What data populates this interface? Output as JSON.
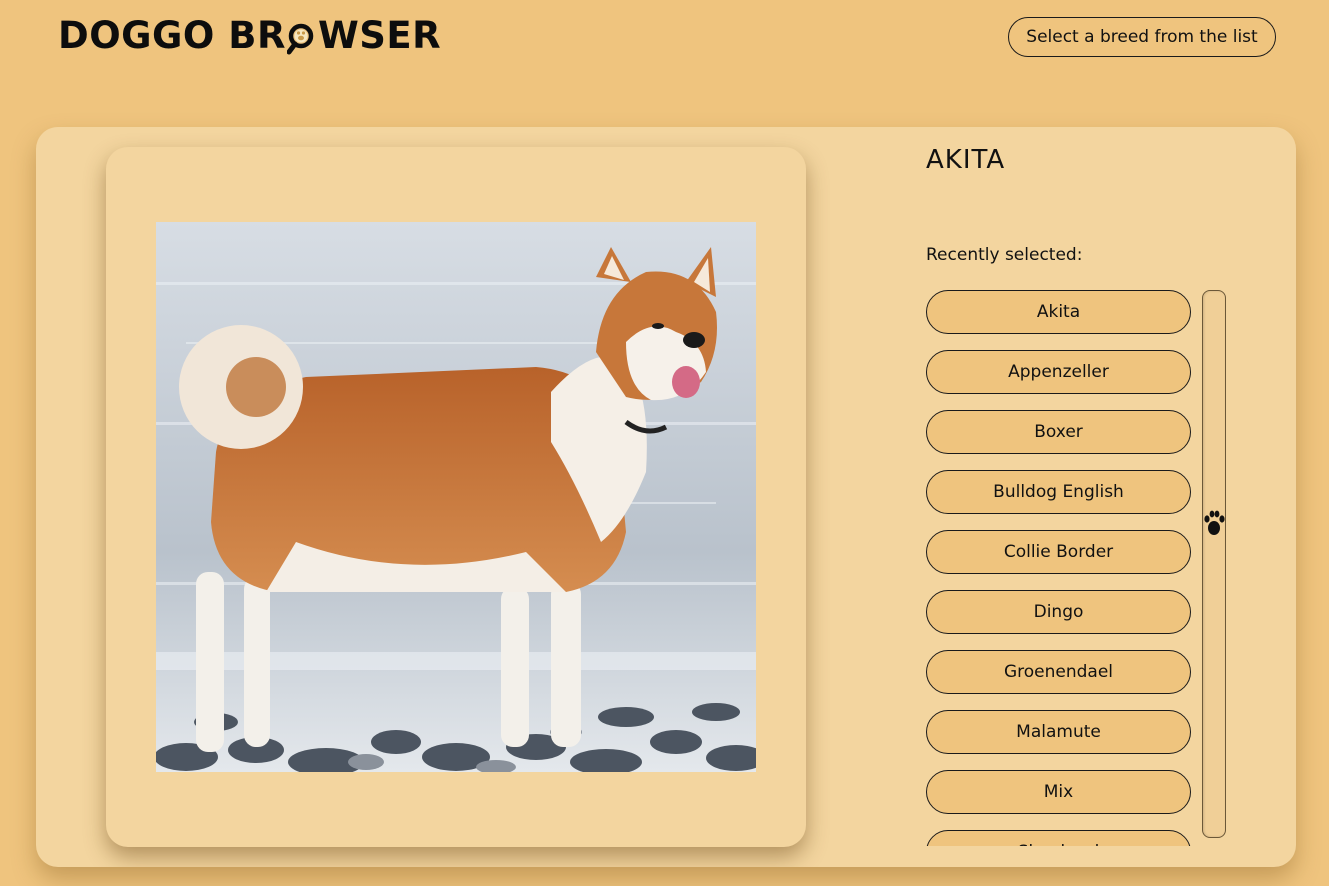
{
  "header": {
    "logo_part1": "DOGGO BR",
    "logo_part2": "WSER",
    "select_prompt": "Select a breed from the list"
  },
  "breed": {
    "title": "AKITA",
    "photo_icon": "dog-photo"
  },
  "recent": {
    "label": "Recently selected:",
    "items": [
      {
        "label": "Akita"
      },
      {
        "label": "Appenzeller"
      },
      {
        "label": "Boxer"
      },
      {
        "label": "Bulldog English"
      },
      {
        "label": "Collie Border"
      },
      {
        "label": "Dingo"
      },
      {
        "label": "Groenendael"
      },
      {
        "label": "Malamute"
      },
      {
        "label": "Mix"
      },
      {
        "label": "Shepherd"
      }
    ]
  },
  "scrollbar": {
    "thumb_icon": "paw-print-icon",
    "position": 0.42
  },
  "colors": {
    "background": "#efc47e",
    "card": "#f3d59f",
    "button": "#efc47e",
    "text": "#111111"
  }
}
